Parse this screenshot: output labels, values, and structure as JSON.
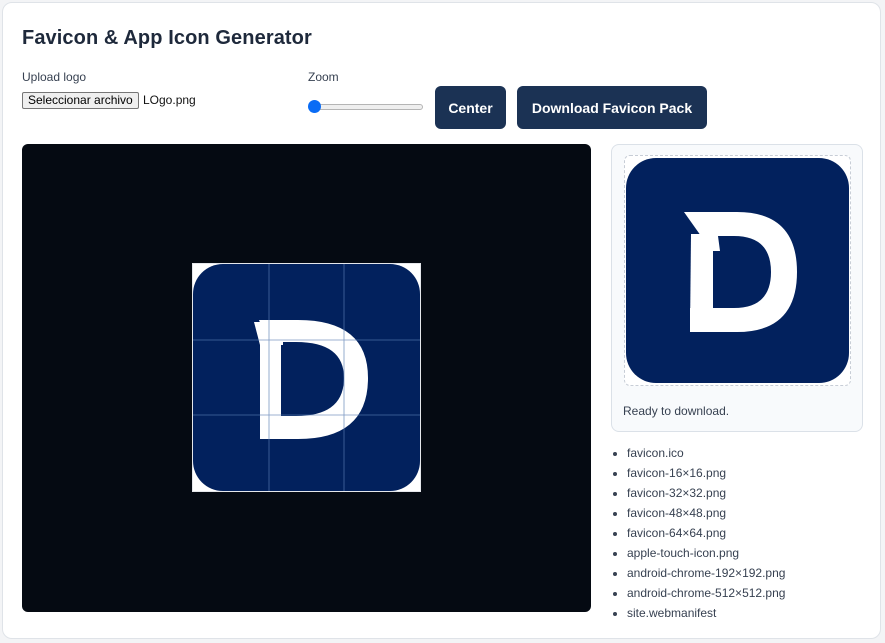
{
  "title": "Favicon & App Icon Generator",
  "upload": {
    "label": "Upload logo",
    "button_label": "Seleccionar archivo",
    "file_name": "LOgo.png"
  },
  "zoom": {
    "label": "Zoom",
    "value_fraction": 0.0
  },
  "buttons": {
    "center": "Center",
    "download": "Download Favicon Pack"
  },
  "preview": {
    "status": "Ready to download."
  },
  "files": [
    "favicon.ico",
    "favicon-16×16.png",
    "favicon-32×32.png",
    "favicon-48×48.png",
    "favicon-64×64.png",
    "apple-touch-icon.png",
    "android-chrome-192×192.png",
    "android-chrome-512×512.png",
    "site.webmanifest"
  ],
  "colors": {
    "canvas_bg": "#050a12",
    "logo_bg": "#02215d",
    "logo_fg": "#ffffff",
    "button_bg": "#1b3254",
    "slider_accent": "#0a6cf5"
  },
  "icons": {
    "logo": "letter-d-logo-icon"
  }
}
